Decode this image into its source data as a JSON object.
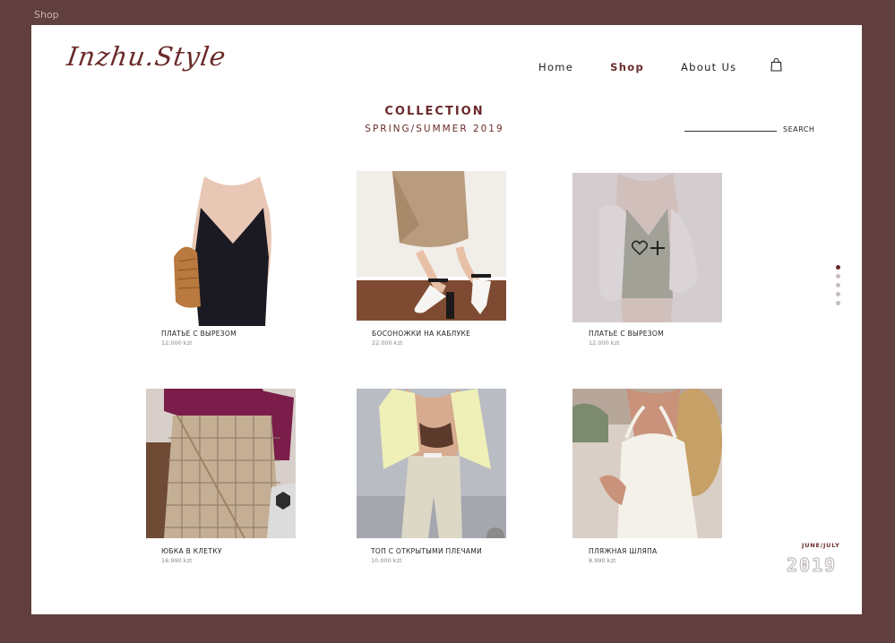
{
  "window": {
    "title": "Shop"
  },
  "brand": {
    "logo": "Inzhu.Style"
  },
  "nav": {
    "home": "Home",
    "shop": "Shop",
    "about": "About Us"
  },
  "collection": {
    "title": "COLLECTION",
    "subtitle": "SPRING/SUMMER 2019"
  },
  "search": {
    "label": "SEARCH"
  },
  "products": [
    {
      "name": "ПЛАТЬЕ С ВЫРЕЗОМ",
      "price": "12.000 kzt"
    },
    {
      "name": "БОСОНОЖКИ НА КАБЛУКЕ",
      "price": "22.000 kzt"
    },
    {
      "name": "ПЛАТЬЕ С ВЫРЕЗОМ",
      "price": "12.000 kzt"
    },
    {
      "name": "ЮБКА В КЛЕТКУ",
      "price": "16.990 kzt"
    },
    {
      "name": "ТОП С ОТКРЫТЫМИ ПЛЕЧАМИ",
      "price": "10.000 kzt"
    },
    {
      "name": "ПЛЯЖНАЯ ШЛЯПА",
      "price": "8.990 kzt"
    }
  ],
  "pager": {
    "count": 5,
    "active": 1
  },
  "season": {
    "label": "JUNE/JULY",
    "year": "2019"
  },
  "colors": {
    "frame": "#613f3f",
    "accent": "#6a2a2a",
    "page": "#ffffff"
  },
  "icons": [
    "cart-icon",
    "heart-icon",
    "plus-icon"
  ]
}
